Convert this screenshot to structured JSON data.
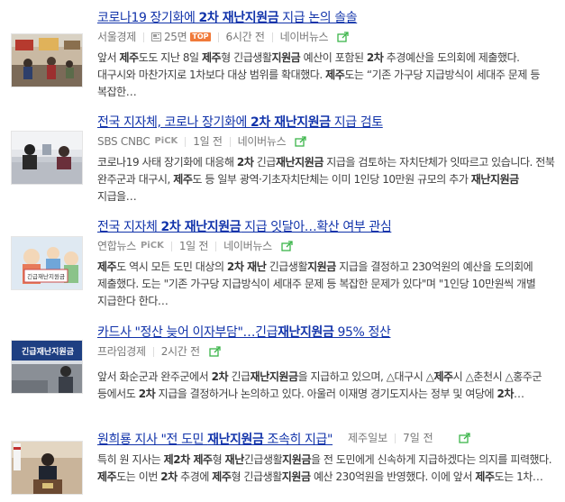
{
  "results": [
    {
      "title": [
        {
          "t": "코로나19 장기화에 ",
          "b": false
        },
        {
          "t": "2차 재난지원금",
          "b": true
        },
        {
          "t": " 지급 논의 솔솔",
          "b": false
        }
      ],
      "source": "서울경제",
      "pick": "",
      "paper_page": "25면",
      "top_badge": "TOP",
      "time": "6시간 전",
      "portal": "네이버뉴스",
      "thumbnail": "market-street-photo",
      "snippet": [
        {
          "t": "앞서 ",
          "b": false
        },
        {
          "t": "제주",
          "b": true
        },
        {
          "t": "도도 지난 8일 ",
          "b": false
        },
        {
          "t": "제주",
          "b": true
        },
        {
          "t": "형 긴급생활",
          "b": false
        },
        {
          "t": "지원금",
          "b": true
        },
        {
          "t": " 예산이 포함된 ",
          "b": false
        },
        {
          "t": "2차",
          "b": true
        },
        {
          "t": " 추경예산을 도의회에 제출했다. 대구시와 마찬가지로 1차보다 대상 범위를 확대했다. ",
          "b": false
        },
        {
          "t": "제주",
          "b": true
        },
        {
          "t": "도는 “기존 가구당 지급방식이 세대주 문제 등 복잡한…",
          "b": false
        }
      ]
    },
    {
      "title": [
        {
          "t": "전국 지자체, 코로나 장기화에 ",
          "b": false
        },
        {
          "t": "2차 재난지원금",
          "b": true
        },
        {
          "t": " 지급 검토",
          "b": false
        }
      ],
      "source": "SBS CNBC",
      "pick": "PiCK",
      "paper_page": "",
      "top_badge": "",
      "time": "1일 전",
      "portal": "네이버뉴스",
      "thumbnail": "office-counter-photo",
      "snippet": [
        {
          "t": "코로나19 사태 장기화에 대응해 ",
          "b": false
        },
        {
          "t": "2차",
          "b": true
        },
        {
          "t": " 긴급",
          "b": false
        },
        {
          "t": "재난지원금",
          "b": true
        },
        {
          "t": " 지급을 검토하는 자치단체가 잇따르고 있습니다. 전북 완주군과 대구시, ",
          "b": false
        },
        {
          "t": "제주",
          "b": true
        },
        {
          "t": "도 등 일부 광역·기초자치단체는 이미 1인당 10만원 규모의 추가 ",
          "b": false
        },
        {
          "t": "재난지원금",
          "b": true
        },
        {
          "t": " 지급을…",
          "b": false
        }
      ]
    },
    {
      "title": [
        {
          "t": "전국 지자체 ",
          "b": false
        },
        {
          "t": "2차 재난지원금",
          "b": true
        },
        {
          "t": " 지급 잇달아…확산 여부 관심",
          "b": false
        }
      ],
      "source": "연합뉴스",
      "pick": "PiCK",
      "paper_page": "",
      "top_badge": "",
      "time": "1일 전",
      "portal": "네이버뉴스",
      "thumbnail": "support-fund-illustration",
      "thumb_caption": "긴급재난지원금",
      "snippet": [
        {
          "t": "제주",
          "b": true
        },
        {
          "t": "도 역시 모든 도민 대상의 ",
          "b": false
        },
        {
          "t": "2차 재난",
          "b": true
        },
        {
          "t": " 긴급생활",
          "b": false
        },
        {
          "t": "지원금",
          "b": true
        },
        {
          "t": " 지급을 결정하고 230억원의 예산을 도의회에 제출했다. 도는 \"기존 가구당 지급방식이 세대주 문제 등 복잡한 문제가 있다\"며 \"1인당 10만원씩 개별 지급한다 한다…",
          "b": false
        }
      ]
    },
    {
      "title": [
        {
          "t": "카드사 \"정산 늦어 이자부담\"…긴급",
          "b": false
        },
        {
          "t": "재난지원금",
          "b": true
        },
        {
          "t": " 95% 정산",
          "b": false
        }
      ],
      "source": "프라임경제",
      "pick": "",
      "paper_page": "",
      "top_badge": "",
      "time": "2시간 전",
      "portal": "",
      "thumbnail": "emergency-fund-banner-photo",
      "thumb_caption": "긴급재난지원금",
      "snippet": [
        {
          "t": "앞서 화순군과 완주군에서 ",
          "b": false
        },
        {
          "t": "2차",
          "b": true
        },
        {
          "t": " 긴급",
          "b": false
        },
        {
          "t": "재난지원금",
          "b": true
        },
        {
          "t": "을 지급하고 있으며, △대구시 △",
          "b": false
        },
        {
          "t": "제주",
          "b": true
        },
        {
          "t": "시 △춘천시 △홍주군 등에서도 ",
          "b": false
        },
        {
          "t": "2차",
          "b": true
        },
        {
          "t": " 지급을 결정하거나 논의하고 있다. 아울러 이재명 경기도지사는 정부 및 여당에 ",
          "b": false
        },
        {
          "t": "2차",
          "b": true
        },
        {
          "t": "…",
          "b": false
        }
      ]
    },
    {
      "title": [
        {
          "t": "원희룡 지사 \"전 도민 ",
          "b": false
        },
        {
          "t": "재난지원금",
          "b": true
        },
        {
          "t": " 조속히 지급\"",
          "b": false
        }
      ],
      "source": "제주일보",
      "pick": "",
      "paper_page": "",
      "top_badge": "",
      "time": "7일 전",
      "portal": "",
      "thumbnail": "governor-podium-photo",
      "snippet": [
        {
          "t": "특히 원 지사는 ",
          "b": false
        },
        {
          "t": "제2차 제주",
          "b": true
        },
        {
          "t": "형 ",
          "b": false
        },
        {
          "t": "재난",
          "b": true
        },
        {
          "t": "긴급생활",
          "b": false
        },
        {
          "t": "지원금",
          "b": true
        },
        {
          "t": "을 전 도민에게 신속하게 지급하겠다는 의지를 피력했다. ",
          "b": false
        },
        {
          "t": "제주",
          "b": true
        },
        {
          "t": "도는 이번 ",
          "b": false
        },
        {
          "t": "2차",
          "b": true
        },
        {
          "t": " 추경에 ",
          "b": false
        },
        {
          "t": "제주",
          "b": true
        },
        {
          "t": "형 긴급생활",
          "b": false
        },
        {
          "t": "지원금",
          "b": true
        },
        {
          "t": " 예산 230억원을 반영했다. 이에 앞서 ",
          "b": false
        },
        {
          "t": "제주",
          "b": true
        },
        {
          "t": "도는 1차…",
          "b": false
        }
      ]
    }
  ],
  "colors": {
    "title_link": "#1133aa",
    "meta_text": "#777777",
    "body_text": "#404040",
    "share_icon": "#3cb54a",
    "top_badge": "#f07a3a"
  }
}
